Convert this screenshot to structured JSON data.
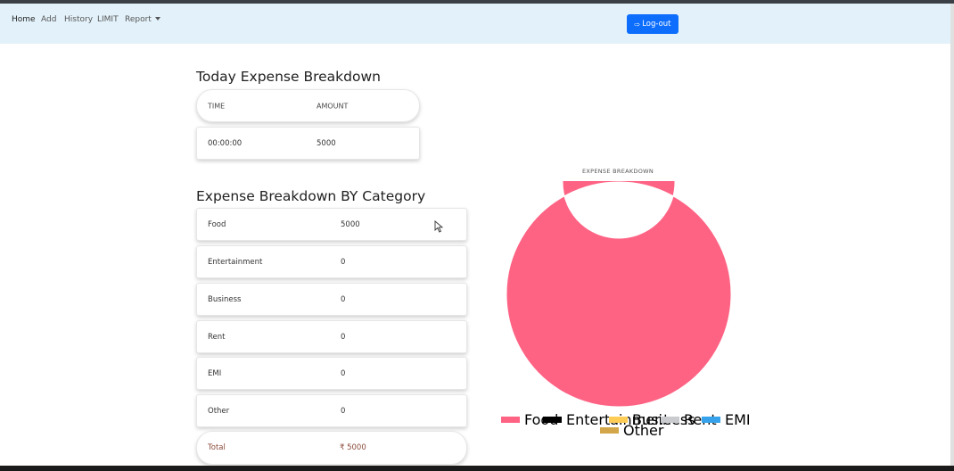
{
  "nav": {
    "items": [
      "Home",
      "Add",
      "History",
      "LIMIT",
      "Report"
    ],
    "logout_label": "Log-out"
  },
  "today": {
    "title": "Today Expense Breakdown",
    "headers": [
      "TIME",
      "AMOUNT"
    ],
    "row": {
      "time": "00:00:00",
      "amount": "5000"
    }
  },
  "category": {
    "title": "Expense Breakdown BY Category",
    "rows": [
      {
        "name": "Food",
        "amount": "5000"
      },
      {
        "name": "Entertainment",
        "amount": "0"
      },
      {
        "name": "Business",
        "amount": "0"
      },
      {
        "name": "Rent",
        "amount": "0"
      },
      {
        "name": "EMI",
        "amount": "0"
      },
      {
        "name": "Other",
        "amount": "0"
      }
    ],
    "total_label": "Total",
    "total_value": "₹ 5000"
  },
  "chart_data": {
    "type": "pie",
    "title": "EXPENSE BREAKDOWN",
    "categories": [
      "Food",
      "Entertainment",
      "Business",
      "Rent",
      "EMI",
      "Other"
    ],
    "values": [
      5000,
      0,
      0,
      0,
      0,
      0
    ],
    "colors": [
      "#ff6384",
      "#000000",
      "#ffcd56",
      "#c9cbcf",
      "#36a2eb",
      "#d4a64a"
    ],
    "donut": true,
    "legend_position": "bottom"
  }
}
